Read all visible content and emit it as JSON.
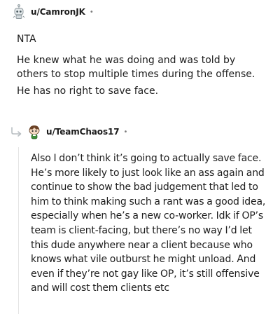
{
  "comments": [
    {
      "username": "u/CamronJK",
      "separator": "•",
      "avatar_icon": "robot-snoo-avatar-icon",
      "paragraphs": [
        "NTA",
        "He knew what he was doing and was told by others to stop multiple times during the offense.",
        "He has no right to save face."
      ]
    },
    {
      "username": "u/TeamChaos17",
      "separator": "•",
      "avatar_icon": "brown-hair-snoo-avatar-icon",
      "reply_icon": "reply-arrow-icon",
      "paragraphs": [
        "Also I don’t think it’s going to actually save face. He’s more likely to just look like an ass again and continue to show the bad judgement that led to him to think making such a rant was a good idea, especially when he’s a new co-worker. Idk if OP’s team is client-facing, but there’s no way I’d let this dude anywhere near a client because who knows what vile outburst he might unload. And even if they’re not gay like OP, it’s still offensive and will cost them clients etc"
      ]
    }
  ],
  "colors": {
    "text": "#1c1c1c",
    "meta": "#7c7c7c",
    "thread_line": "#e4e4e4"
  }
}
